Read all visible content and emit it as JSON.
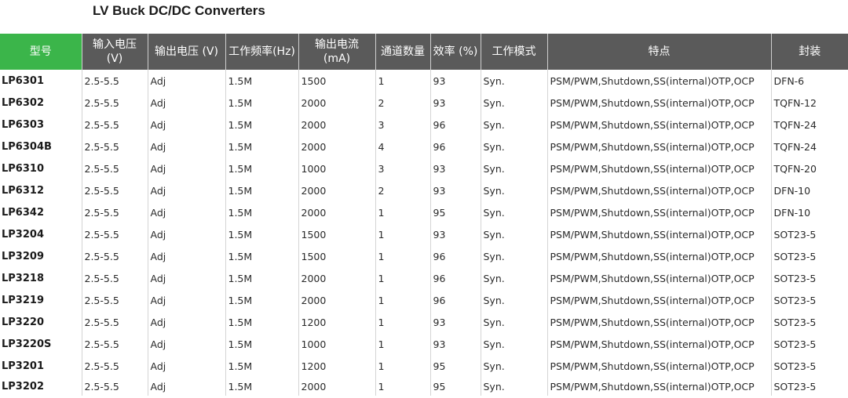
{
  "title": "LV Buck DC/DC Converters",
  "colors": {
    "header_first": "#3bb54a",
    "header": "#5a5a5a"
  },
  "headers": [
    "型号",
    "输入电压\n(V)",
    "输出电压 (V)",
    "工作频率(Hz)",
    "输出电流\n(mA)",
    "通道数量",
    "效率 (%)",
    "工作模式",
    "特点",
    "封装"
  ],
  "rows": [
    [
      "LP6301",
      "2.5-5.5",
      "Adj",
      "1.5M",
      "1500",
      "1",
      "93",
      "Syn.",
      "PSM/PWM,Shutdown,SS(internal)OTP,OCP",
      "DFN-6"
    ],
    [
      "LP6302",
      "2.5-5.5",
      "Adj",
      "1.5M",
      "2000",
      "2",
      "93",
      "Syn.",
      "PSM/PWM,Shutdown,SS(internal)OTP,OCP",
      "TQFN-12"
    ],
    [
      "LP6303",
      "2.5-5.5",
      "Adj",
      "1.5M",
      "2000",
      "3",
      "96",
      "Syn.",
      "PSM/PWM,Shutdown,SS(internal)OTP,OCP",
      "TQFN-24"
    ],
    [
      "LP6304B",
      "2.5-5.5",
      "Adj",
      "1.5M",
      "2000",
      "4",
      "96",
      "Syn.",
      "PSM/PWM,Shutdown,SS(internal)OTP,OCP",
      "TQFN-24"
    ],
    [
      "LP6310",
      "2.5-5.5",
      "Adj",
      "1.5M",
      "1000",
      "3",
      "93",
      "Syn.",
      "PSM/PWM,Shutdown,SS(internal)OTP,OCP",
      "TQFN-20"
    ],
    [
      "LP6312",
      "2.5-5.5",
      "Adj",
      "1.5M",
      "2000",
      "2",
      "93",
      "Syn.",
      "PSM/PWM,Shutdown,SS(internal)OTP,OCP",
      "DFN-10"
    ],
    [
      "LP6342",
      "2.5-5.5",
      "Adj",
      "1.5M",
      "2000",
      "1",
      "95",
      "Syn.",
      "PSM/PWM,Shutdown,SS(internal)OTP,OCP",
      "DFN-10"
    ],
    [
      "LP3204",
      "2.5-5.5",
      "Adj",
      "1.5M",
      "1500",
      "1",
      "93",
      "Syn.",
      "PSM/PWM,Shutdown,SS(internal)OTP,OCP",
      "SOT23-5"
    ],
    [
      "LP3209",
      "2.5-5.5",
      "Adj",
      "1.5M",
      "1500",
      "1",
      "96",
      "Syn.",
      "PSM/PWM,Shutdown,SS(internal)OTP,OCP",
      "SOT23-5"
    ],
    [
      "LP3218",
      "2.5-5.5",
      "Adj",
      "1.5M",
      "2000",
      "1",
      "96",
      "Syn.",
      "PSM/PWM,Shutdown,SS(internal)OTP,OCP",
      "SOT23-5"
    ],
    [
      "LP3219",
      "2.5-5.5",
      "Adj",
      "1.5M",
      "2000",
      "1",
      "96",
      "Syn.",
      "PSM/PWM,Shutdown,SS(internal)OTP,OCP",
      "SOT23-5"
    ],
    [
      "LP3220",
      "2.5-5.5",
      "Adj",
      "1.5M",
      "1200",
      "1",
      "93",
      "Syn.",
      "PSM/PWM,Shutdown,SS(internal)OTP,OCP",
      "SOT23-5"
    ],
    [
      "LP3220S",
      "2.5-5.5",
      "Adj",
      "1.5M",
      "1000",
      "1",
      "93",
      "Syn.",
      "PSM/PWM,Shutdown,SS(internal)OTP,OCP",
      "SOT23-5"
    ],
    [
      "LP3201",
      "2.5-5.5",
      "Adj",
      "1.5M",
      "1200",
      "1",
      "95",
      "Syn.",
      "PSM/PWM,Shutdown,SS(internal)OTP,OCP",
      "SOT23-5"
    ],
    [
      "LP3202",
      "2.5-5.5",
      "Adj",
      "1.5M",
      "2000",
      "1",
      "95",
      "Syn.",
      "PSM/PWM,Shutdown,SS(internal)OTP,OCP",
      "SOT23-5"
    ]
  ]
}
